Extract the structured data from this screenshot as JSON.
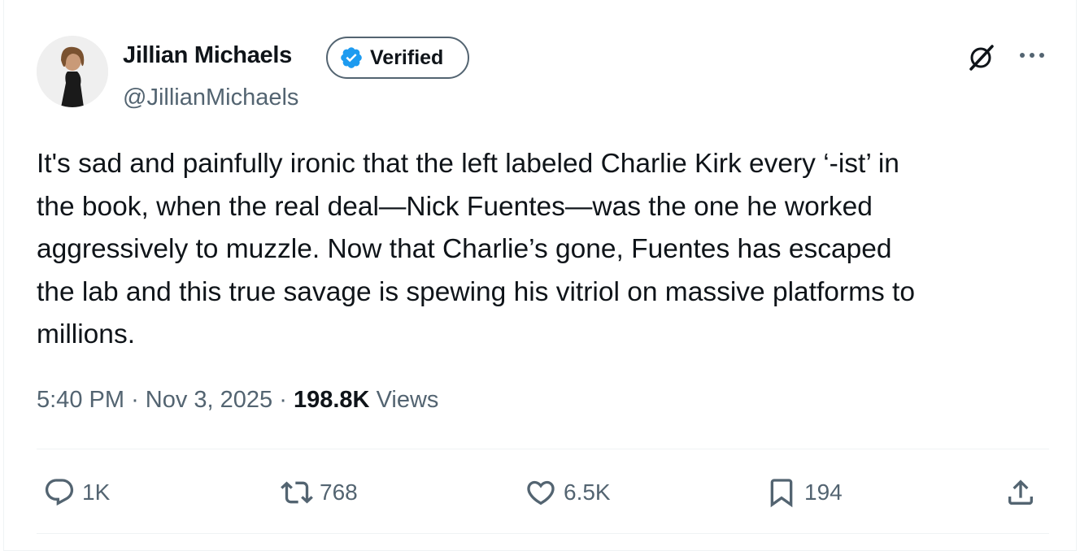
{
  "author": {
    "name": "Jillian Michaels",
    "verified_label": "Verified",
    "handle": "@JillianMichaels"
  },
  "post": {
    "text": "It's sad and painfully ironic that the left labeled Charlie Kirk every ‘-ist’ in\nthe book, when the real deal—Nick Fuentes—was the one he worked\naggressively to muzzle. Now that Charlie’s gone, Fuentes has escaped\nthe lab and this true savage is spewing his vitriol on massive platforms to\nmillions.",
    "time": "5:40 PM",
    "separator": "·",
    "date": "Nov 3, 2025",
    "views_count": "198.8K",
    "views_label": "Views"
  },
  "actions": {
    "replies": "1K",
    "reposts": "768",
    "likes": "6.5K",
    "bookmarks": "194"
  },
  "icons": {
    "verified": "verified-badge-icon",
    "grok": "grok-icon",
    "more": "more-icon",
    "reply": "reply-icon",
    "repost": "repost-icon",
    "like": "heart-icon",
    "bookmark": "bookmark-icon",
    "share": "share-icon"
  },
  "colors": {
    "text": "#0f1419",
    "secondary": "#536471",
    "verified_blue": "#1d9bf0",
    "divider": "#eff3f4"
  }
}
